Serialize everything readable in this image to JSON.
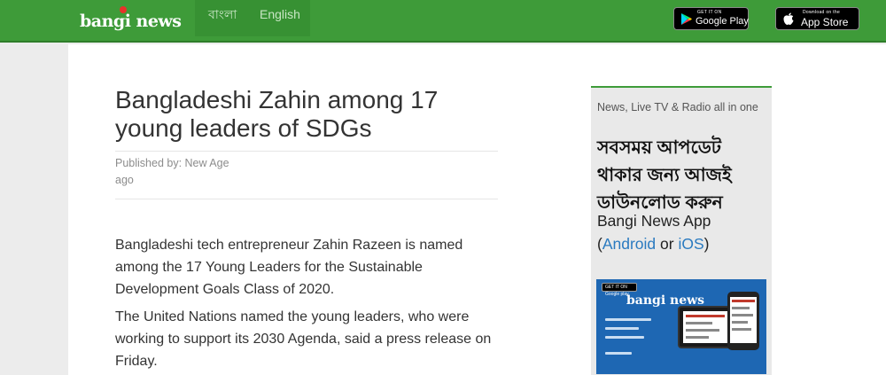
{
  "header": {
    "logo_text": "bangi news",
    "languages": [
      "বাংলা",
      "English"
    ],
    "google_play": {
      "small": "GET IT ON",
      "big": "Google Play"
    },
    "app_store": {
      "small": "Download on the",
      "big": "App Store"
    }
  },
  "article": {
    "title": "Bangladeshi Zahin among 17 young leaders of SDGs",
    "byline": "Published by: New Age",
    "time": "ago",
    "paragraphs": [
      "Bangladeshi tech entrepreneur Zahin Razeen is named among the 17 Young Leaders for the Sustainable Development Goals Class of 2020.",
      "The United Nations named the young leaders, who were working to support its 2030 Agenda, said a press release on Friday."
    ]
  },
  "sidebar": {
    "tagline": "News, Live TV & Radio all in one",
    "bangla_text": "সবসময় আপডেট থাকার জন্য আজই ডাউনলোড করুন",
    "app_name": "Bangi News App",
    "paren_open": "(",
    "android": "Android",
    "or": "or",
    "ios": "iOS",
    "paren_close": ")",
    "banner": {
      "badge": "GET IT ON Google play",
      "logo": "bangi news"
    }
  },
  "colors": {
    "brand_green": "#3e9b39",
    "link_blue": "#2a7ac0",
    "banner_blue": "#1e67b3"
  }
}
